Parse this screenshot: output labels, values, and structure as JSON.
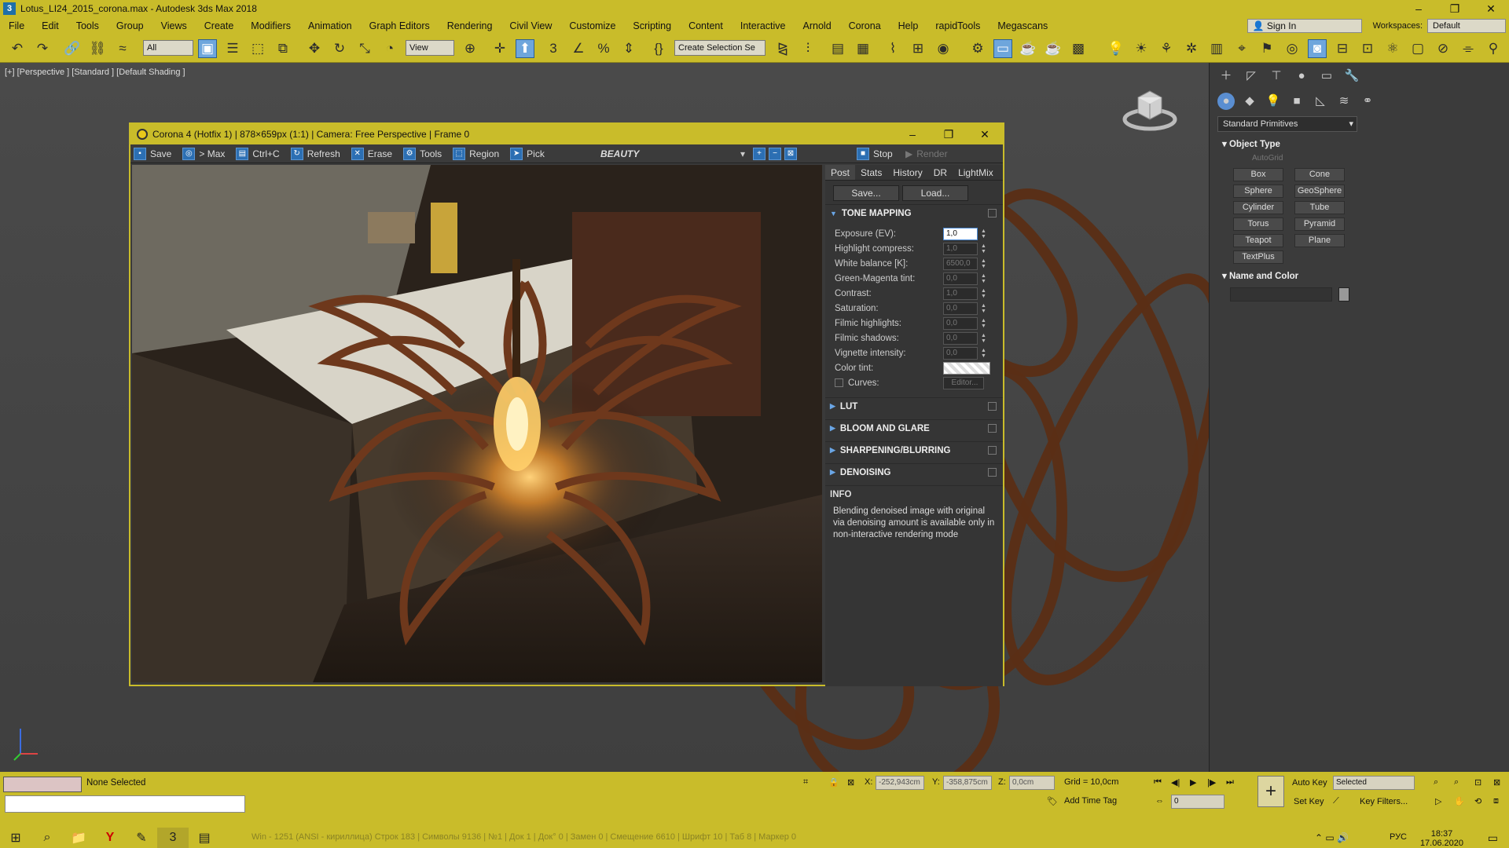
{
  "app": {
    "title": "Lotus_LI24_2015_corona.max - Autodesk 3ds Max 2018",
    "icon_label": "3"
  },
  "window_controls": {
    "minimize": "–",
    "restore": "❐",
    "close": "✕"
  },
  "menu": [
    "File",
    "Edit",
    "Tools",
    "Group",
    "Views",
    "Create",
    "Modifiers",
    "Animation",
    "Graph Editors",
    "Rendering",
    "Civil View",
    "Customize",
    "Scripting",
    "Content",
    "Interactive",
    "Arnold",
    "Corona",
    "Help",
    "rapidTools",
    "Megascans"
  ],
  "account": {
    "sign_in": "Sign In",
    "workspaces_label": "Workspaces:",
    "workspace_value": "Default"
  },
  "toolbar": {
    "filter_value": "All",
    "view_value": "View",
    "selection_set_placeholder": "Create Selection Se"
  },
  "viewport": {
    "label": "[+] [Perspective ] [Standard ] [Default Shading ]"
  },
  "command_panel": {
    "category": "Standard Primitives",
    "object_type_title": "Object Type",
    "autogrid": "AutoGrid",
    "primitives": [
      "Box",
      "Cone",
      "Sphere",
      "GeoSphere",
      "Cylinder",
      "Tube",
      "Torus",
      "Pyramid",
      "Teapot",
      "Plane",
      "TextPlus"
    ],
    "name_color_title": "Name and Color"
  },
  "vfb": {
    "title": "Corona 4 (Hotfix 1) | 878×659px (1:1) | Camera: Free Perspective | Frame 0",
    "tools": {
      "save": "Save",
      "max": "> Max",
      "copy": "Ctrl+C",
      "refresh": "Refresh",
      "erase": "Erase",
      "tools": "Tools",
      "region": "Region",
      "pick": "Pick",
      "stop": "Stop",
      "render": "Render"
    },
    "channel": "BEAUTY",
    "tabs": [
      "Post",
      "Stats",
      "History",
      "DR",
      "LightMix"
    ],
    "save_btn": "Save...",
    "load_btn": "Load...",
    "sections": {
      "tone_mapping": "TONE MAPPING",
      "lut": "LUT",
      "bloom": "BLOOM AND GLARE",
      "sharpening": "SHARPENING/BLURRING",
      "denoising": "DENOISING",
      "info": "INFO"
    },
    "params": [
      {
        "label": "Exposure (EV):",
        "value": "1,0"
      },
      {
        "label": "Highlight compress:",
        "value": "1,0"
      },
      {
        "label": "White balance [K]:",
        "value": "6500,0"
      },
      {
        "label": "Green-Magenta tint:",
        "value": "0,0"
      },
      {
        "label": "Contrast:",
        "value": "1,0"
      },
      {
        "label": "Saturation:",
        "value": "0,0"
      },
      {
        "label": "Filmic highlights:",
        "value": "0,0"
      },
      {
        "label": "Filmic shadows:",
        "value": "0,0"
      },
      {
        "label": "Vignette intensity:",
        "value": "0,0"
      }
    ],
    "color_tint": "Color tint:",
    "curves": "Curves:",
    "curves_editor": "Editor...",
    "info_text": "Blending denoised image with original via denoising amount is available only in non-interactive rendering mode"
  },
  "status": {
    "selection": "None Selected",
    "x_label": "X:",
    "x_value": "-252,943cm",
    "y_label": "Y:",
    "y_value": "-358,875cm",
    "z_label": "Z:",
    "z_value": "0,0cm",
    "grid": "Grid = 10,0cm",
    "add_time_tag": "Add Time Tag",
    "auto_key": "Auto Key",
    "set_key": "Set Key",
    "key_mode": "Selected",
    "key_filters": "Key Filters...",
    "frame": "0"
  },
  "taskbar": {
    "faint_text": "Win - 1251 (ANSI - кириллица)                     Строк 183 | Символы 9136 | №1 | Док 1 | Док° 0 | Замен 0 | Смещение 6610 | Шрифт 10 | Таб 8 | Маркер 0",
    "lang": "РУС",
    "time": "18:37",
    "date": "17.06.2020"
  }
}
